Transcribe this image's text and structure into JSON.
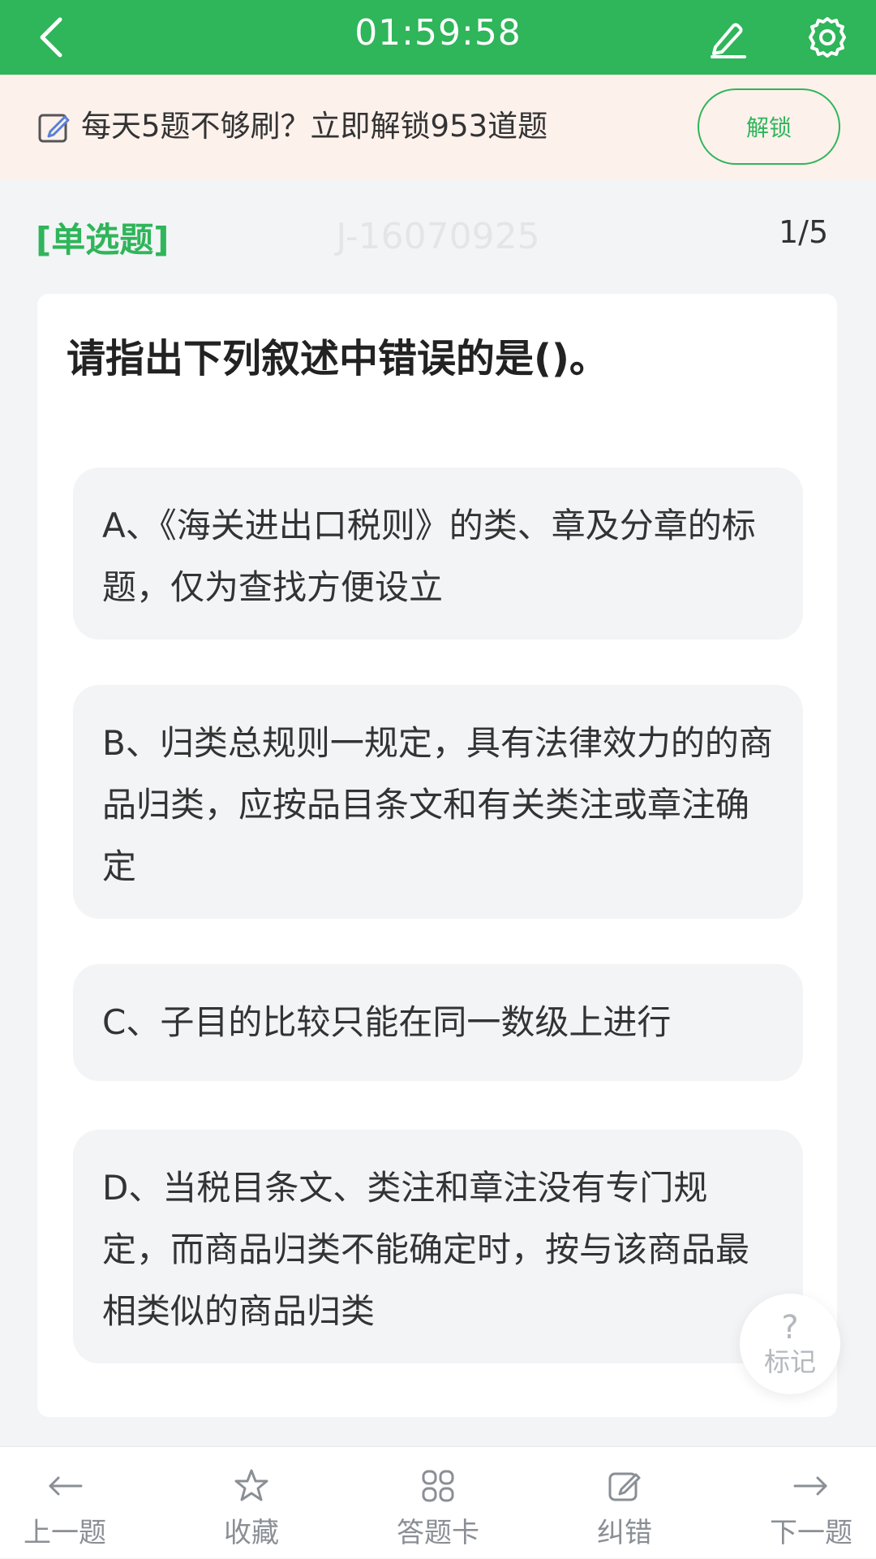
{
  "header": {
    "timer": "01:59:58"
  },
  "promo": {
    "text": "每天5题不够刷？立即解锁953道题",
    "button_label": "解锁"
  },
  "question": {
    "type_label": "[单选题]",
    "watermark": "J-16070925",
    "counter": "1/5",
    "title": "请指出下列叙述中错误的是()。",
    "options": [
      {
        "text": "A、《海关进出口税则》的类、章及分章的标题，仅为查找方便设立"
      },
      {
        "text": "B、归类总规则一规定，具有法律效力的的商品归类，应按品目条文和有关类注或章注确定"
      },
      {
        "text": "C、子目的比较只能在同一数级上进行"
      },
      {
        "text": "D、当税目条文、类注和章注没有专门规定，而商品归类不能确定时，按与该商品最相类似的商品归类"
      }
    ]
  },
  "mark": {
    "icon": "?",
    "label": "标记"
  },
  "bottom_bar": {
    "items": [
      {
        "label": "上一题",
        "icon": "arrow-left-icon"
      },
      {
        "label": "收藏",
        "icon": "star-icon"
      },
      {
        "label": "答题卡",
        "icon": "grid-icon"
      },
      {
        "label": "纠错",
        "icon": "edit-icon"
      },
      {
        "label": "下一题",
        "icon": "arrow-right-icon"
      }
    ]
  },
  "colors": {
    "brand": "#2fb55a",
    "promo_bg": "#fdf1ec",
    "page_bg": "#f3f4f6",
    "option_bg": "#f3f4f6"
  }
}
